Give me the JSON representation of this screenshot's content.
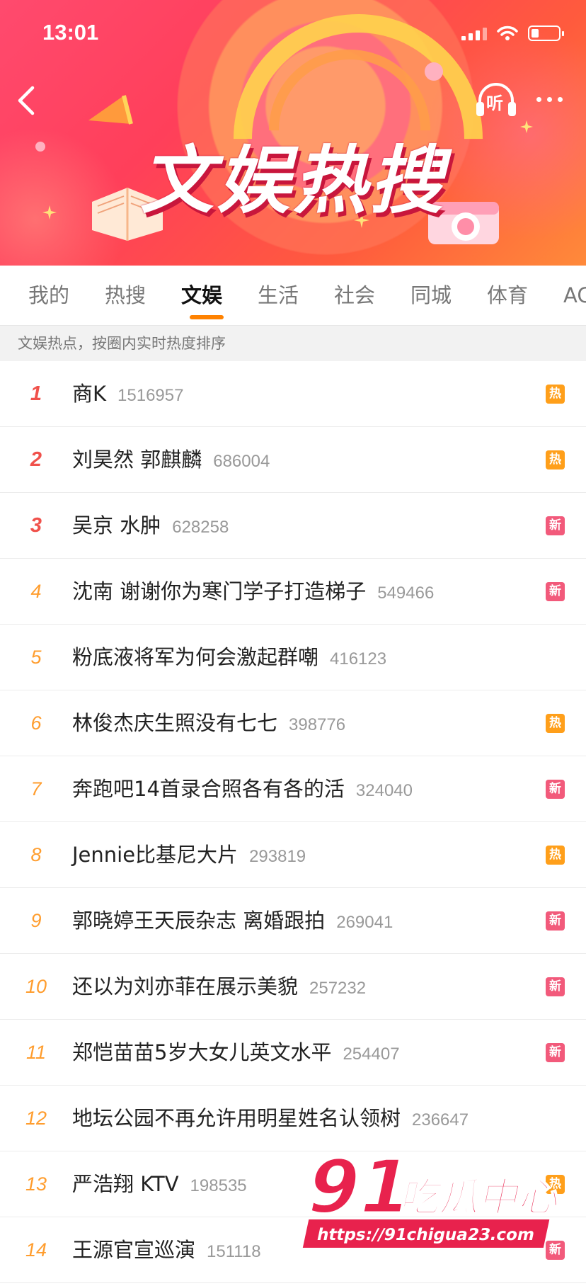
{
  "status_bar": {
    "time": "13:01"
  },
  "header": {
    "title": "文娱热搜",
    "listen_label": "听"
  },
  "tabs": [
    {
      "label": "我的",
      "active": false
    },
    {
      "label": "热搜",
      "active": false
    },
    {
      "label": "文娱",
      "active": true
    },
    {
      "label": "生活",
      "active": false
    },
    {
      "label": "社会",
      "active": false
    },
    {
      "label": "同城",
      "active": false
    },
    {
      "label": "体育",
      "active": false
    },
    {
      "label": "AC",
      "active": false
    }
  ],
  "subtitle": "文娱热点，按圈内实时热度排序",
  "list": [
    {
      "rank": "1",
      "title": "商K",
      "count": "1516957",
      "badge": "热",
      "badge_type": "hot"
    },
    {
      "rank": "2",
      "title": "刘昊然 郭麒麟",
      "count": "686004",
      "badge": "热",
      "badge_type": "hot"
    },
    {
      "rank": "3",
      "title": "吴京 水肿",
      "count": "628258",
      "badge": "新",
      "badge_type": "new"
    },
    {
      "rank": "4",
      "title": "沈南 谢谢你为寒门学子打造梯子",
      "count": "549466",
      "badge": "新",
      "badge_type": "new"
    },
    {
      "rank": "5",
      "title": "粉底液将军为何会激起群嘲",
      "count": "416123",
      "badge": "",
      "badge_type": ""
    },
    {
      "rank": "6",
      "title": "林俊杰庆生照没有七七",
      "count": "398776",
      "badge": "热",
      "badge_type": "hot"
    },
    {
      "rank": "7",
      "title": "奔跑吧14首录合照各有各的活",
      "count": "324040",
      "badge": "新",
      "badge_type": "new"
    },
    {
      "rank": "8",
      "title": "Jennie比基尼大片",
      "count": "293819",
      "badge": "热",
      "badge_type": "hot"
    },
    {
      "rank": "9",
      "title": "郭晓婷王天辰杂志 离婚跟拍",
      "count": "269041",
      "badge": "新",
      "badge_type": "new"
    },
    {
      "rank": "10",
      "title": "还以为刘亦菲在展示美貌",
      "count": "257232",
      "badge": "新",
      "badge_type": "new"
    },
    {
      "rank": "11",
      "title": "郑恺苗苗5岁大女儿英文水平",
      "count": "254407",
      "badge": "新",
      "badge_type": "new"
    },
    {
      "rank": "12",
      "title": "地坛公园不再允许用明星姓名认领树",
      "count": "236647",
      "badge": "",
      "badge_type": ""
    },
    {
      "rank": "13",
      "title": "严浩翔 KTV",
      "count": "198535",
      "badge": "热",
      "badge_type": "hot"
    },
    {
      "rank": "14",
      "title": "王源官宣巡演",
      "count": "151118",
      "badge": "新",
      "badge_type": "new"
    }
  ],
  "watermark": {
    "logo_text": "91吃瓜中心",
    "url": "https://91chigua23.com"
  },
  "colors": {
    "accent": "#ff8200",
    "hot": "#ff9f1a",
    "new": "#f25a7b",
    "rank_top": "#f0514b",
    "rank": "#ff9d2e"
  }
}
